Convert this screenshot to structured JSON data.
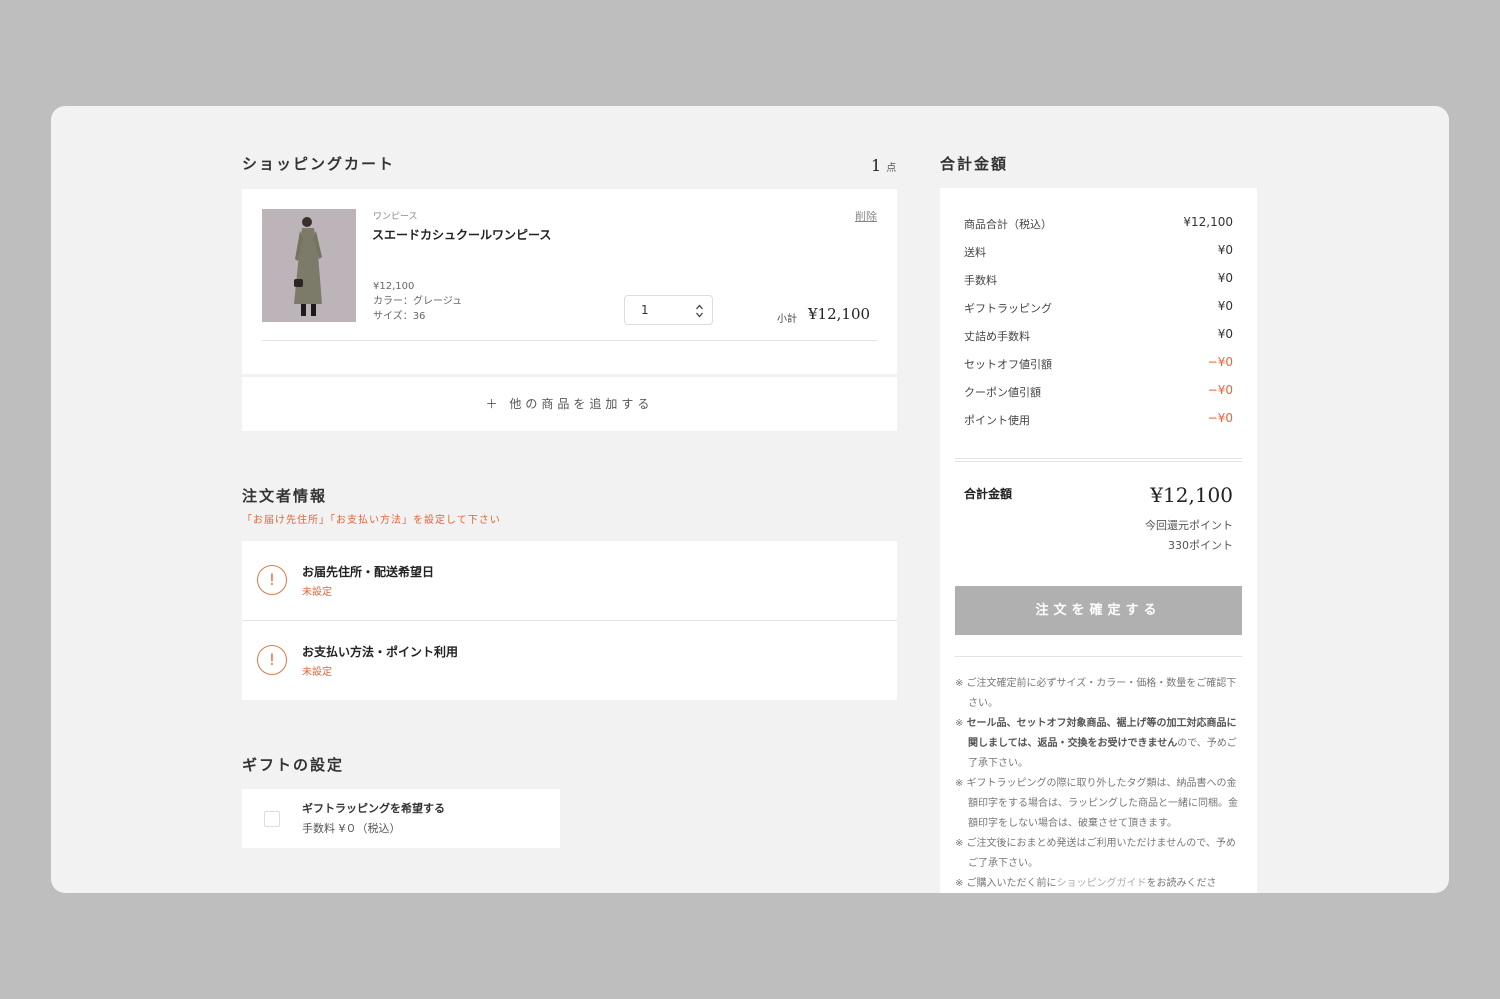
{
  "cart": {
    "title": "ショッピングカート",
    "count": "1",
    "count_unit": "点",
    "item": {
      "category": "ワンピース",
      "name": "スエードカシュクールワンピース",
      "price": "¥12,100",
      "color": "カラー：グレージュ",
      "size": "サイズ：36",
      "delete_label": "削除",
      "quantity": "1",
      "subtotal_label": "小計",
      "subtotal": "¥12,100"
    },
    "add_more_label": "＋ 他の商品を追加する"
  },
  "order_info": {
    "title": "注文者情報",
    "warning": "「お届け先住所」「お支払い方法」を設定して下さい",
    "rows": [
      {
        "title": "お届先住所・配送希望日",
        "status": "未設定"
      },
      {
        "title": "お支払い方法・ポイント利用",
        "status": "未設定"
      }
    ]
  },
  "gift": {
    "title": "ギフトの設定",
    "checkbox_label": "ギフトラッピングを希望する",
    "fee": "手数料 ¥０（税込）"
  },
  "summary": {
    "title": "合計金額",
    "rows": [
      {
        "label": "商品合計（税込）",
        "value": "¥12,100"
      },
      {
        "label": "送料",
        "value": "¥0"
      },
      {
        "label": "手数料",
        "value": "¥0"
      },
      {
        "label": "ギフトラッピング",
        "value": "¥0"
      },
      {
        "label": "丈詰め手数料",
        "value": "¥0"
      },
      {
        "label": "セットオフ値引額",
        "value": "−¥0"
      },
      {
        "label": "クーポン値引額",
        "value": "−¥0"
      },
      {
        "label": "ポイント使用",
        "value": "−¥0"
      }
    ],
    "total_label": "合計金額",
    "total_value": "¥12,100",
    "points_label": "今回還元ポイント",
    "points_value": "330ポイント",
    "confirm_label": "注文を確定する",
    "notes": {
      "n1": "※ ご注文確定前に必ずサイズ・カラー・価格・数量をご確認下さい。",
      "n2_bold": "セール品、セットオフ対象商品、裾上げ等の加工対応商品に関しましては、返品・交換をお受けできません",
      "n2_rest": "ので、予めご了承下さい。",
      "n3": "※ ギフトラッピングの際に取り外したタグ類は、納品書への金額印字をする場合は、ラッピングした商品と一緒に同梱。金額印字をしない場合は、破棄させて頂きます。",
      "n4": "※ ご注文後におまとめ発送はご利用いただけませんので、予めご了承下さい。",
      "n5_pre": "※ ご購入いただく前に",
      "n5_link": "ショッピングガイド",
      "n5_post": "をお読みくださ"
    }
  },
  "colors": {
    "accent": "#e0663a",
    "button_disabled": "#b0b0b0",
    "page_bg": "#bebebe",
    "frame_bg": "#f2f2f2"
  }
}
